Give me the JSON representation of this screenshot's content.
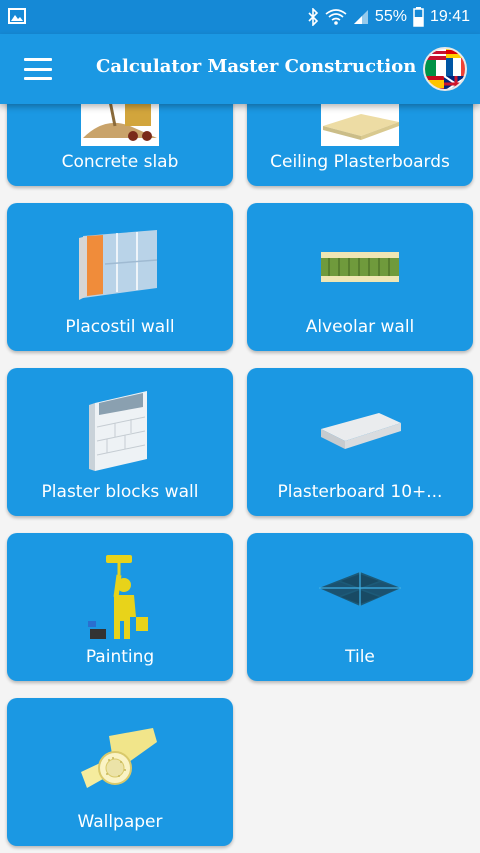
{
  "status_bar": {
    "battery": "55%",
    "time": "19:41",
    "icons": [
      "image-icon",
      "bluetooth-icon",
      "wifi-icon",
      "signal-icon",
      "battery-icon"
    ]
  },
  "app_bar": {
    "title": "Calculator Master Construction",
    "menu_icon": "hamburger-menu-icon",
    "language_icon": "language-globe-icon"
  },
  "cards": [
    {
      "label": "Concrete slab",
      "icon": "concrete-slab-icon"
    },
    {
      "label": "Ceiling Plasterboards",
      "icon": "ceiling-plasterboard-icon"
    },
    {
      "label": "Placostil wall",
      "icon": "placostil-wall-icon"
    },
    {
      "label": "Alveolar wall",
      "icon": "alveolar-wall-icon"
    },
    {
      "label": "Plaster blocks wall",
      "icon": "plaster-blocks-icon"
    },
    {
      "label": "Plasterboard 10+...",
      "icon": "plasterboard-icon"
    },
    {
      "label": "Painting",
      "icon": "painter-icon"
    },
    {
      "label": "Tile",
      "icon": "tile-icon"
    },
    {
      "label": "Wallpaper",
      "icon": "wallpaper-roll-icon"
    }
  ],
  "colors": {
    "status_bar": "#1589d6",
    "app_bar": "#1b98e3",
    "card": "#1b98e3",
    "background": "#f4f4f4"
  }
}
